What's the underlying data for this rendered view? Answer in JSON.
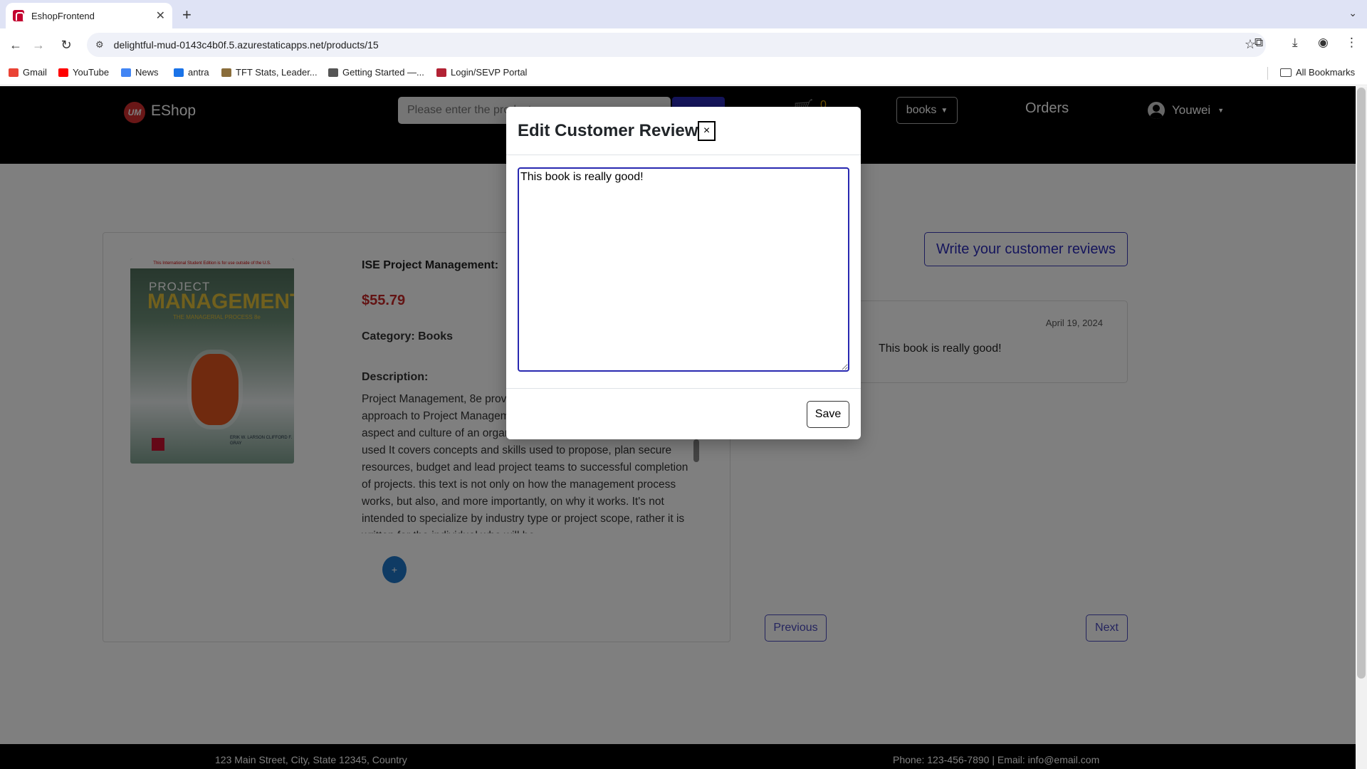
{
  "browser": {
    "tab_title": "EshopFrontend",
    "url": "delightful-mud-0143c4b0f.5.azurestaticapps.net/products/15",
    "bookmarks": [
      {
        "label": "Gmail",
        "color": "#ea4335"
      },
      {
        "label": "YouTube",
        "color": "#ff0000"
      },
      {
        "label": "News",
        "color": "#4285f4"
      },
      {
        "label": "antra",
        "color": "#1a73e8"
      },
      {
        "label": "TFT Stats, Leader...",
        "color": "#8a6d3b"
      },
      {
        "label": "Getting Started —...",
        "color": "#555555"
      },
      {
        "label": "Login/SEVP Portal",
        "color": "#b22234"
      }
    ],
    "all_bookmarks": "All Bookmarks"
  },
  "header": {
    "logo_badge": "UM",
    "logo_text": "EShop",
    "search_placeholder": "Please enter the product",
    "cart_count": "0",
    "category": "books",
    "orders": "Orders",
    "user": "Youwei"
  },
  "product": {
    "cover": {
      "banner": "This International Student Edition is for use outside of the U.S.",
      "title_line1": "PROJECT",
      "title_line2": "MANAGEMENT",
      "subtitle": "THE MANAGERIAL PROCESS 8e",
      "authors": "ERIK W. LARSON CLIFFORD F. GRAY"
    },
    "name": "ISE Project Management:",
    "price": "$55.79",
    "category": "Category: Books",
    "description_label": "Description:",
    "description": "Project Management, 8e provides a holistic, socio-technical approach to Project Management that addresses both the technical aspect and culture of an organization where the tools are being used It covers concepts and skills used to propose, plan secure resources, budget and lead project teams to successful completion of projects. this text is not only on how the management process works, but also, and more importantly, on why it works. It's not intended to specialize by industry type or project scope, rather it is written for the individual who will be",
    "add_button": "+"
  },
  "reviews": {
    "write_button": "Write your customer reviews",
    "items": [
      {
        "date": "April 19, 2024",
        "text": "This book is really good!"
      }
    ],
    "previous": "Previous",
    "next": "Next"
  },
  "footer": {
    "left": "123 Main Street, City, State 12345, Country",
    "right": "Phone: 123-456-7890 | Email: info@email.com"
  },
  "modal": {
    "title": "Edit Customer Reviews:",
    "close": "×",
    "review_text": "This book is really good!",
    "save": "Save"
  }
}
